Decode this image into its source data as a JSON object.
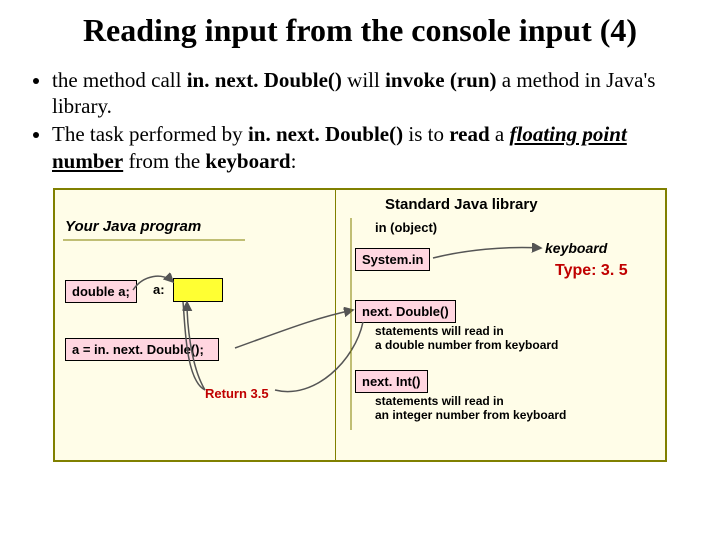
{
  "title": "Reading input from the console input (4)",
  "bullets": [
    {
      "pre": "the method call ",
      "b1": "in. next. Double()",
      "mid": " will ",
      "b2": "invoke (run)",
      "post": " a method in Java's library."
    },
    {
      "pre": "The task performed by ",
      "b1": "in. next. Double()",
      "mid": " is to ",
      "b2": "read",
      "post1": " a ",
      "fpn": "floating point",
      "post2": " ",
      "num": "number",
      "post3": " from the ",
      "kb": "keyboard",
      "end": ":"
    }
  ],
  "diagram": {
    "left_title": "Your Java program",
    "right_title": "Standard Java library",
    "decl": "double a;",
    "avar": "a:",
    "call": "a = in. next. Double();",
    "ret": "Return 3.5",
    "in_obj": "in (object)",
    "system_in": "System.in",
    "next_double": "next. Double()",
    "nd_desc1": "statements will read in",
    "nd_desc2": "a double number from keyboard",
    "next_int": "next. Int()",
    "ni_desc1": "statements will read in",
    "ni_desc2": "an integer number from keyboard",
    "keyboard": "keyboard",
    "typed": "Type: 3. 5"
  }
}
